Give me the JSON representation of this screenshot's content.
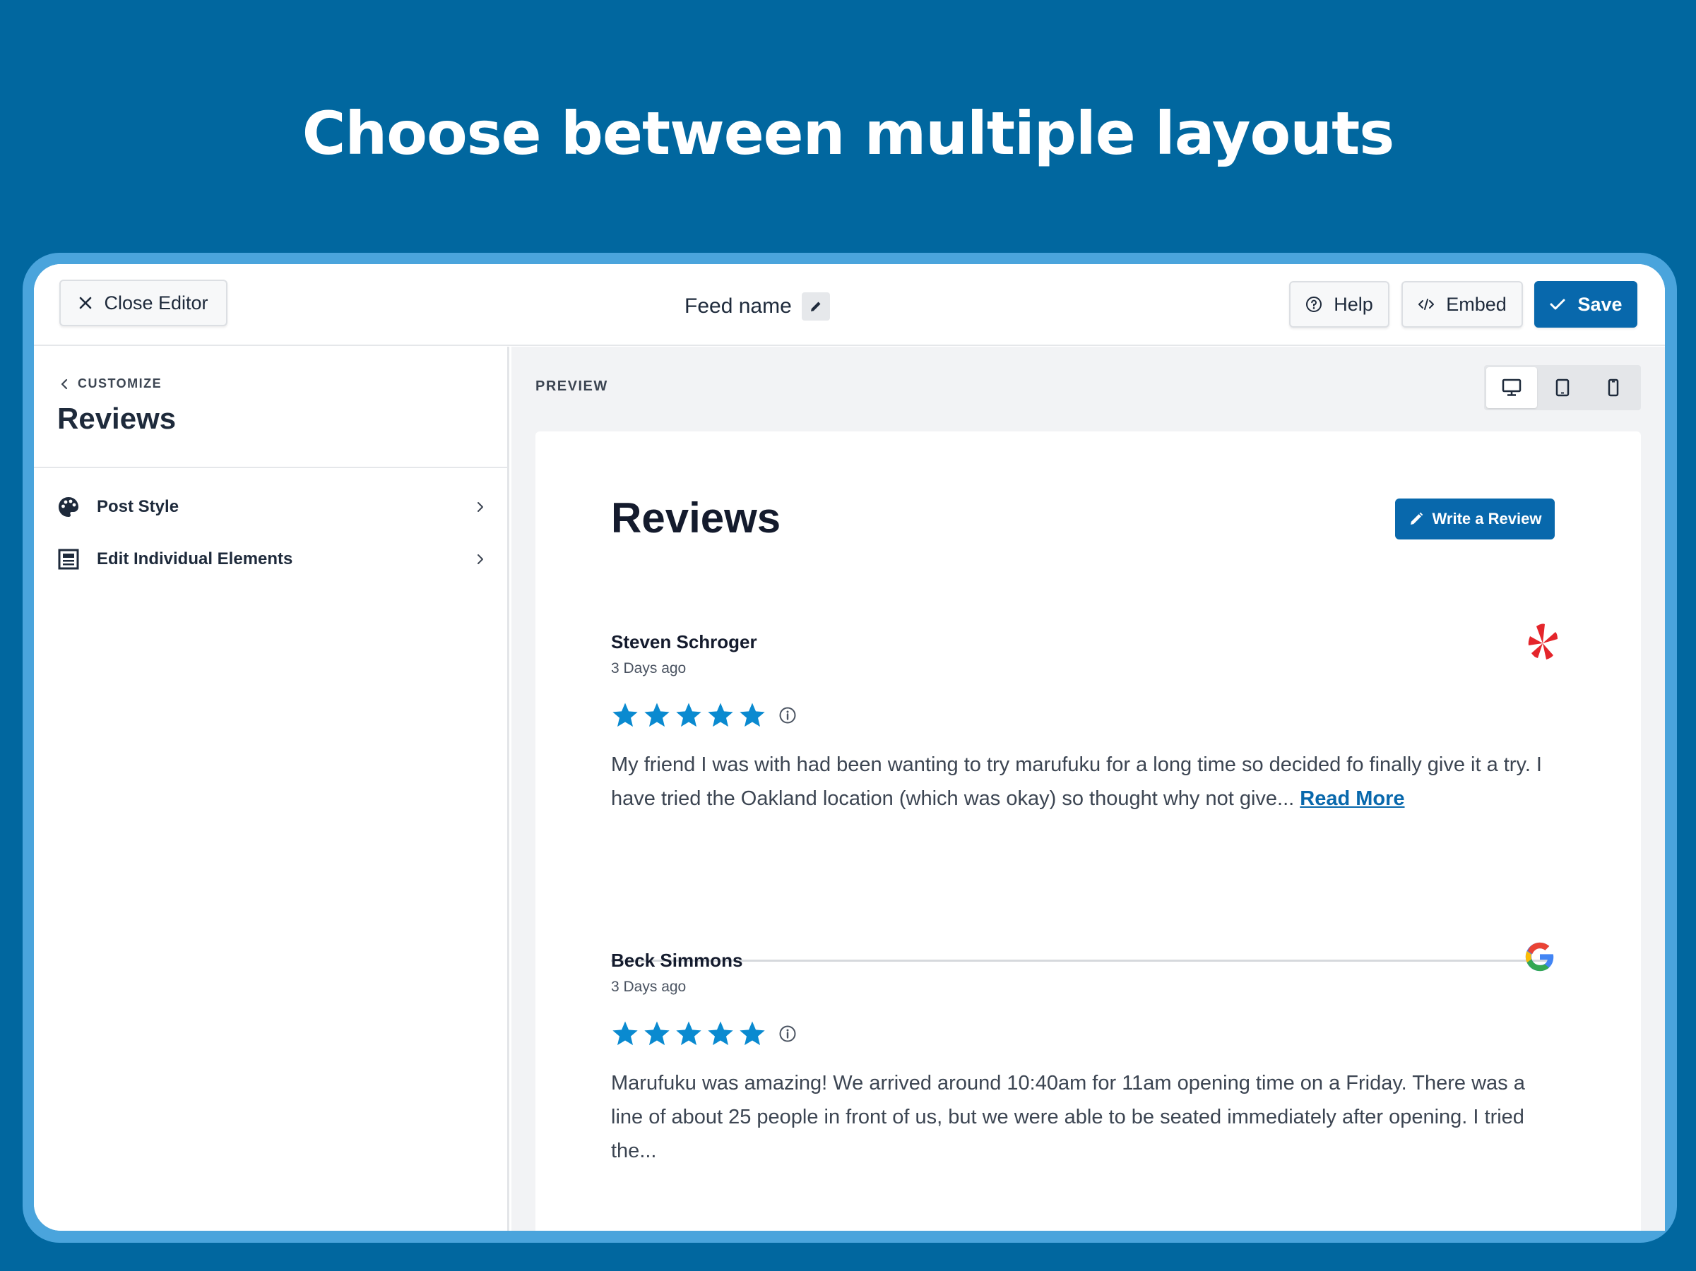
{
  "hero": {
    "title": "Choose between multiple layouts"
  },
  "topbar": {
    "close_label": "Close Editor",
    "feed_name": "Feed name",
    "help_label": "Help",
    "embed_label": "Embed",
    "save_label": "Save"
  },
  "sidebar": {
    "crumb": "CUSTOMIZE",
    "title": "Reviews",
    "items": [
      {
        "label": "Post Style",
        "icon": "palette-icon"
      },
      {
        "label": "Edit Individual Elements",
        "icon": "layout-icon"
      }
    ]
  },
  "preview": {
    "label": "PREVIEW",
    "devices": [
      "desktop-icon",
      "tablet-icon",
      "mobile-icon"
    ],
    "active_device": "desktop",
    "card_title": "Reviews",
    "write_review_label": "Write a Review",
    "reviews": [
      {
        "name": "Steven Schroger",
        "date": "3 Days ago",
        "rating": 5,
        "text": "My friend I was with had been wanting to try marufuku for a long time so decided fo finally give it a try. I have tried the Oakland location (which was okay) so thought why not give...",
        "read_more": "Read More",
        "source": "yelp-icon"
      },
      {
        "name": "Beck Simmons",
        "date": "3 Days ago",
        "rating": 5,
        "text": "Marufuku was amazing! We arrived around 10:40am for 11am opening time on a Friday. There was a line of about 25 people in front of us, but we were able to be seated immediately after opening. I tried the...",
        "source": "google-icon"
      }
    ]
  },
  "colors": {
    "background": "#01679f",
    "frame": "#4aa4dc",
    "accent": "#0868ac",
    "star": "#0a8ad0",
    "yelp": "#e4252b"
  }
}
